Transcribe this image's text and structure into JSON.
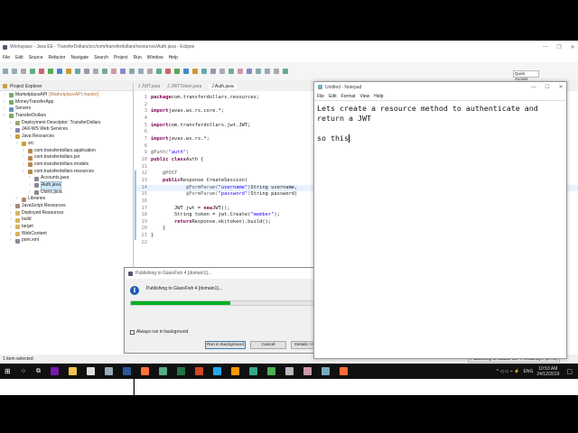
{
  "eclipse": {
    "title": "Workspace - Java EE - TransferDollars/src/com/transferdollars/resources/Auth.java - Eclipse",
    "menu": [
      "File",
      "Edit",
      "Source",
      "Refactor",
      "Navigate",
      "Search",
      "Project",
      "Run",
      "Window",
      "Help"
    ],
    "quick_access": "Quick Access",
    "explorer": {
      "title": "Project Explorer",
      "items": [
        {
          "label": "MarketplaceAPI",
          "suffix": "[MarketplaceAPI master]",
          "depth": 0,
          "icon": "project",
          "color": "#7a6"
        },
        {
          "label": "MoneyTransferApp",
          "depth": 0,
          "icon": "project",
          "color": "#7a6"
        },
        {
          "label": "Servers",
          "depth": 0,
          "icon": "folder",
          "color": "#6a8fc0"
        },
        {
          "label": "TransferDollars",
          "depth": 0,
          "icon": "project",
          "color": "#7a6"
        },
        {
          "label": "Deployment Descriptor: TransferDollars",
          "depth": 1,
          "icon": "descriptor",
          "color": "#9a7"
        },
        {
          "label": "JAX-WS Web Services",
          "depth": 1,
          "icon": "ws",
          "color": "#88a"
        },
        {
          "label": "Java Resources",
          "depth": 1,
          "icon": "java-resources",
          "color": "#c9a040"
        },
        {
          "label": "src",
          "depth": 2,
          "icon": "src-folder",
          "color": "#c9a040"
        },
        {
          "label": "com.transferdollars.application",
          "depth": 3,
          "icon": "package",
          "color": "#b8864b"
        },
        {
          "label": "com.transferdollars.jwt",
          "depth": 3,
          "icon": "package",
          "color": "#b8864b"
        },
        {
          "label": "com.transferdollars.models",
          "depth": 3,
          "icon": "package",
          "color": "#b8864b"
        },
        {
          "label": "com.transferdollars.resources",
          "depth": 3,
          "icon": "package",
          "color": "#b8864b"
        },
        {
          "label": "Accounts.java",
          "depth": 4,
          "icon": "java-file",
          "color": "#889"
        },
        {
          "label": "Auth.java",
          "depth": 4,
          "icon": "java-file",
          "color": "#889",
          "selected": true
        },
        {
          "label": "Users.java",
          "depth": 4,
          "icon": "java-file",
          "color": "#889"
        },
        {
          "label": "Libraries",
          "depth": 2,
          "icon": "library",
          "color": "#a87"
        },
        {
          "label": "JavaScript Resources",
          "depth": 1,
          "icon": "js",
          "color": "#a87"
        },
        {
          "label": "Deployed Resources",
          "depth": 1,
          "icon": "folder",
          "color": "#d9b45a"
        },
        {
          "label": "build",
          "depth": 1,
          "icon": "folder",
          "color": "#d9b45a"
        },
        {
          "label": "target",
          "depth": 1,
          "icon": "folder",
          "color": "#d9b45a"
        },
        {
          "label": "WebContent",
          "depth": 1,
          "icon": "folder",
          "color": "#d9b45a"
        },
        {
          "label": "pom.xml",
          "depth": 1,
          "icon": "xml-file",
          "color": "#889"
        }
      ]
    },
    "tabs": [
      {
        "label": "JWT.java"
      },
      {
        "label": "JWTToken.java"
      },
      {
        "label": "Auth.java",
        "active": true
      }
    ],
    "code": [
      [
        [
          "kw",
          "package"
        ],
        [
          "",
          "com.transferdollars.resources;"
        ]
      ],
      [],
      [
        [
          "kw",
          "import"
        ],
        [
          "",
          "javax.ws.rs.core.*;"
        ]
      ],
      [],
      [
        [
          "kw",
          "import"
        ],
        [
          "",
          "com.transferdollars.jwt.JWT;"
        ]
      ],
      [],
      [
        [
          "kw",
          "import"
        ],
        [
          "",
          "javax.ws.rs.*;"
        ]
      ],
      [],
      [
        [
          "ann",
          "@Path("
        ],
        [
          "str",
          "\"auth\""
        ],
        [
          "ann",
          ")"
        ]
      ],
      [
        [
          "kw",
          "public class"
        ],
        [
          "",
          "Auth {"
        ]
      ],
      [],
      [
        [
          "ann",
          "    @POST"
        ]
      ],
      [
        [
          "kw",
          "    public"
        ],
        [
          "",
          "Response CreateSession("
        ]
      ],
      [
        [
          "ann",
          "            @FormParam("
        ],
        [
          "str",
          "\"username\""
        ],
        [
          "ann",
          ")"
        ],
        [
          "",
          "String username,"
        ]
      ],
      [
        [
          "ann",
          "            @FormParam("
        ],
        [
          "str",
          "\"password\""
        ],
        [
          "ann",
          ")"
        ],
        [
          "",
          "String password)"
        ]
      ],
      [],
      [
        [
          "",
          "        JWT jwt = "
        ],
        [
          "kw",
          "new"
        ],
        [
          "",
          "JWT();"
        ]
      ],
      [
        [
          "",
          "        String token = jwt.Create("
        ],
        [
          "str",
          "\"member\""
        ],
        [
          "",
          ");"
        ]
      ],
      [
        [
          "kw",
          "        return"
        ],
        [
          "",
          "Response.ok(token).build();"
        ]
      ],
      [
        [
          "",
          "    }"
        ]
      ],
      [
        [
          "",
          "}"
        ]
      ],
      []
    ],
    "status_left": "1 item selected",
    "status_right": "Publishing to GlassFish 4 ...main1]... (54%)"
  },
  "notepad": {
    "title": "Untitled - Notepad",
    "menu": [
      "File",
      "Edit",
      "Format",
      "View",
      "Help"
    ],
    "text": "Lets create a resource method to authenticate and\nreturn a JWT\n\nso this"
  },
  "dialog": {
    "title": "Publishing to GlassFish 4 [domain1]...",
    "message": "Publishing to GlassFish 4 [domain1]...",
    "progress": 54,
    "checkbox_label": "Always run in background",
    "checked": false,
    "buttons": {
      "run": "Run in Background",
      "cancel": "Cancel",
      "details": "Details >>"
    },
    "progress_color": "#06b025"
  },
  "taskbar": {
    "time": "10:53 AM",
    "date": "24/12/2019",
    "lang": "ENG",
    "apps": [
      {
        "name": "onenote",
        "color": "#7719aa"
      },
      {
        "name": "file-explorer",
        "color": "#f2c14e"
      },
      {
        "name": "app-circle",
        "color": "#ddd"
      },
      {
        "name": "app-window",
        "color": "#9ab"
      },
      {
        "name": "word",
        "color": "#2b579a"
      },
      {
        "name": "firefox",
        "color": "#ff7139"
      },
      {
        "name": "app-device",
        "color": "#5a8"
      },
      {
        "name": "excel",
        "color": "#217346"
      },
      {
        "name": "powerpoint",
        "color": "#d24726"
      },
      {
        "name": "vscode",
        "color": "#23a9f2"
      },
      {
        "name": "sublime",
        "color": "#ff9800"
      },
      {
        "name": "app-terminal",
        "color": "#3a8"
      },
      {
        "name": "chrome",
        "color": "#4caf50"
      },
      {
        "name": "app-gauge",
        "color": "#bbb"
      },
      {
        "name": "eclipse",
        "color": "#c9a"
      },
      {
        "name": "notepad",
        "color": "#7ab"
      },
      {
        "name": "postman",
        "color": "#ff6c37"
      }
    ]
  }
}
